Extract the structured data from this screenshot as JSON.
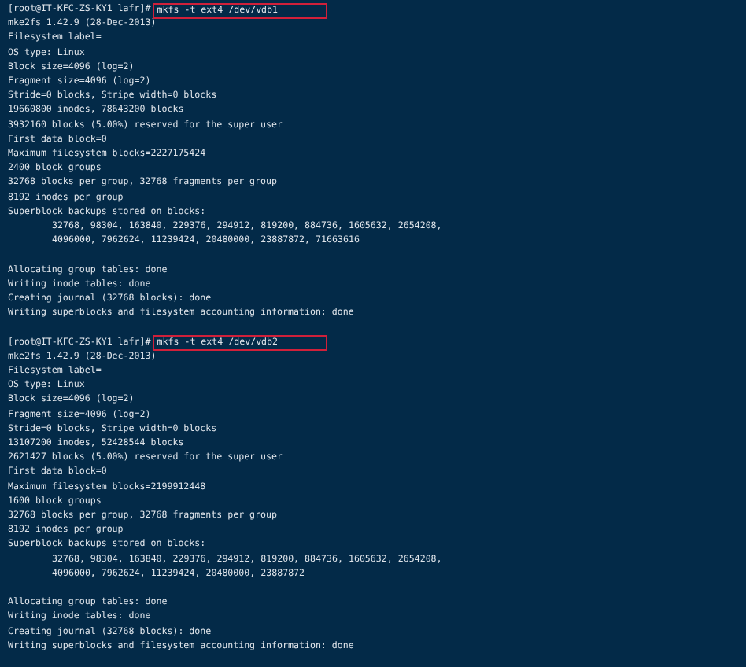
{
  "terminal": {
    "blocks": [
      {
        "prompt": "[root@IT-KFC-ZS-KY1 lafr]#",
        "command": "mkfs -t ext4 /dev/vdb1",
        "sections": [
          [
            {
              "kind": "plain",
              "text": "mke2fs 1.42.9 (28-Dec-2013)"
            },
            {
              "kind": "plain",
              "text": "Filesystem label="
            },
            {
              "kind": "plain",
              "text": "OS type: Linux"
            },
            {
              "kind": "plain",
              "text": "Block size=4096 (log=2)"
            },
            {
              "kind": "plain",
              "text": "Fragment size=4096 (log=2)"
            },
            {
              "kind": "plain",
              "text": "Stride=0 blocks, Stripe width=0 blocks"
            },
            {
              "kind": "plain",
              "text": "19660800 inodes, 78643200 blocks"
            },
            {
              "kind": "plain",
              "text": "3932160 blocks (5.00%) reserved for the super user"
            },
            {
              "kind": "plain",
              "text": "First data block=0"
            },
            {
              "kind": "plain",
              "text": "Maximum filesystem blocks=2227175424"
            },
            {
              "kind": "plain",
              "text": "2400 block groups"
            },
            {
              "kind": "plain",
              "text": "32768 blocks per group, 32768 fragments per group"
            },
            {
              "kind": "plain",
              "text": "8192 inodes per group"
            },
            {
              "kind": "plain",
              "text": "Superblock backups stored on blocks:"
            },
            {
              "kind": "indented",
              "text": "32768, 98304, 163840, 229376, 294912, 819200, 884736, 1605632, 2654208,"
            },
            {
              "kind": "indented",
              "text": "4096000, 7962624, 11239424, 20480000, 23887872, 71663616"
            }
          ],
          [
            {
              "kind": "plain",
              "text": "Allocating group tables: done"
            },
            {
              "kind": "plain",
              "text": "Writing inode tables: done"
            },
            {
              "kind": "plain",
              "text": "Creating journal (32768 blocks): done"
            },
            {
              "kind": "plain",
              "text": "Writing superblocks and filesystem accounting information: done"
            }
          ]
        ]
      },
      {
        "prompt": "[root@IT-KFC-ZS-KY1 lafr]#",
        "command": "mkfs -t ext4 /dev/vdb2",
        "sections": [
          [
            {
              "kind": "plain",
              "text": "mke2fs 1.42.9 (28-Dec-2013)"
            },
            {
              "kind": "plain",
              "text": "Filesystem label="
            },
            {
              "kind": "plain",
              "text": "OS type: Linux"
            },
            {
              "kind": "plain",
              "text": "Block size=4096 (log=2)"
            },
            {
              "kind": "plain",
              "text": "Fragment size=4096 (log=2)"
            },
            {
              "kind": "plain",
              "text": "Stride=0 blocks, Stripe width=0 blocks"
            },
            {
              "kind": "plain",
              "text": "13107200 inodes, 52428544 blocks"
            },
            {
              "kind": "plain",
              "text": "2621427 blocks (5.00%) reserved for the super user"
            },
            {
              "kind": "plain",
              "text": "First data block=0"
            },
            {
              "kind": "plain",
              "text": "Maximum filesystem blocks=2199912448"
            },
            {
              "kind": "plain",
              "text": "1600 block groups"
            },
            {
              "kind": "plain",
              "text": "32768 blocks per group, 32768 fragments per group"
            },
            {
              "kind": "plain",
              "text": "8192 inodes per group"
            },
            {
              "kind": "plain",
              "text": "Superblock backups stored on blocks:"
            },
            {
              "kind": "indented",
              "text": "32768, 98304, 163840, 229376, 294912, 819200, 884736, 1605632, 2654208,"
            },
            {
              "kind": "indented",
              "text": "4096000, 7962624, 11239424, 20480000, 23887872"
            }
          ],
          [
            {
              "kind": "plain",
              "text": "Allocating group tables: done"
            },
            {
              "kind": "plain",
              "text": "Writing inode tables: done"
            },
            {
              "kind": "plain",
              "text": "Creating journal (32768 blocks): done"
            },
            {
              "kind": "plain",
              "text": "Writing superblocks and filesystem accounting information: done"
            }
          ]
        ]
      }
    ]
  }
}
